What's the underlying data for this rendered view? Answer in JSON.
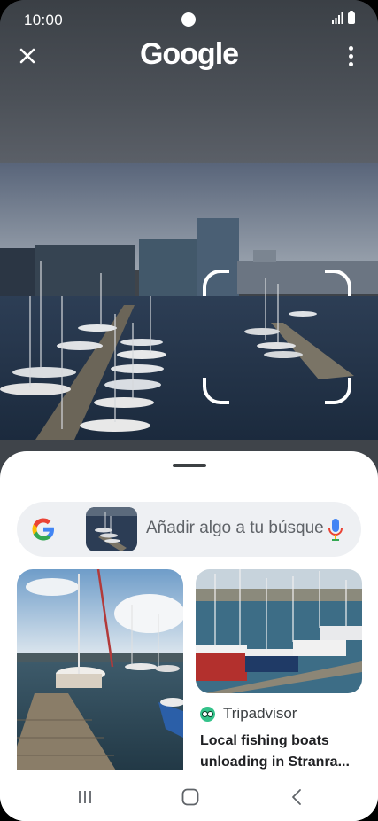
{
  "status_bar": {
    "time": "10:00"
  },
  "app_bar": {
    "title": "Google",
    "close_icon": "close-icon",
    "more_icon": "more-vert-icon"
  },
  "search": {
    "placeholder": "Añadir algo a tu búsqueda",
    "display_text": "Añadir algo a tu búsque"
  },
  "results": [
    {
      "type": "image"
    },
    {
      "source": "Tripadvisor",
      "title": "Local fishing boats unloading in Stranra..."
    }
  ],
  "nav_bar": {
    "buttons": [
      "recent-apps-icon",
      "home-icon",
      "back-icon"
    ]
  },
  "colors": {
    "sheet_bg": "#ffffff",
    "search_bg": "#eef0f3",
    "mic_blue": "#4285f4",
    "tripadvisor_green": "#34c28a"
  }
}
